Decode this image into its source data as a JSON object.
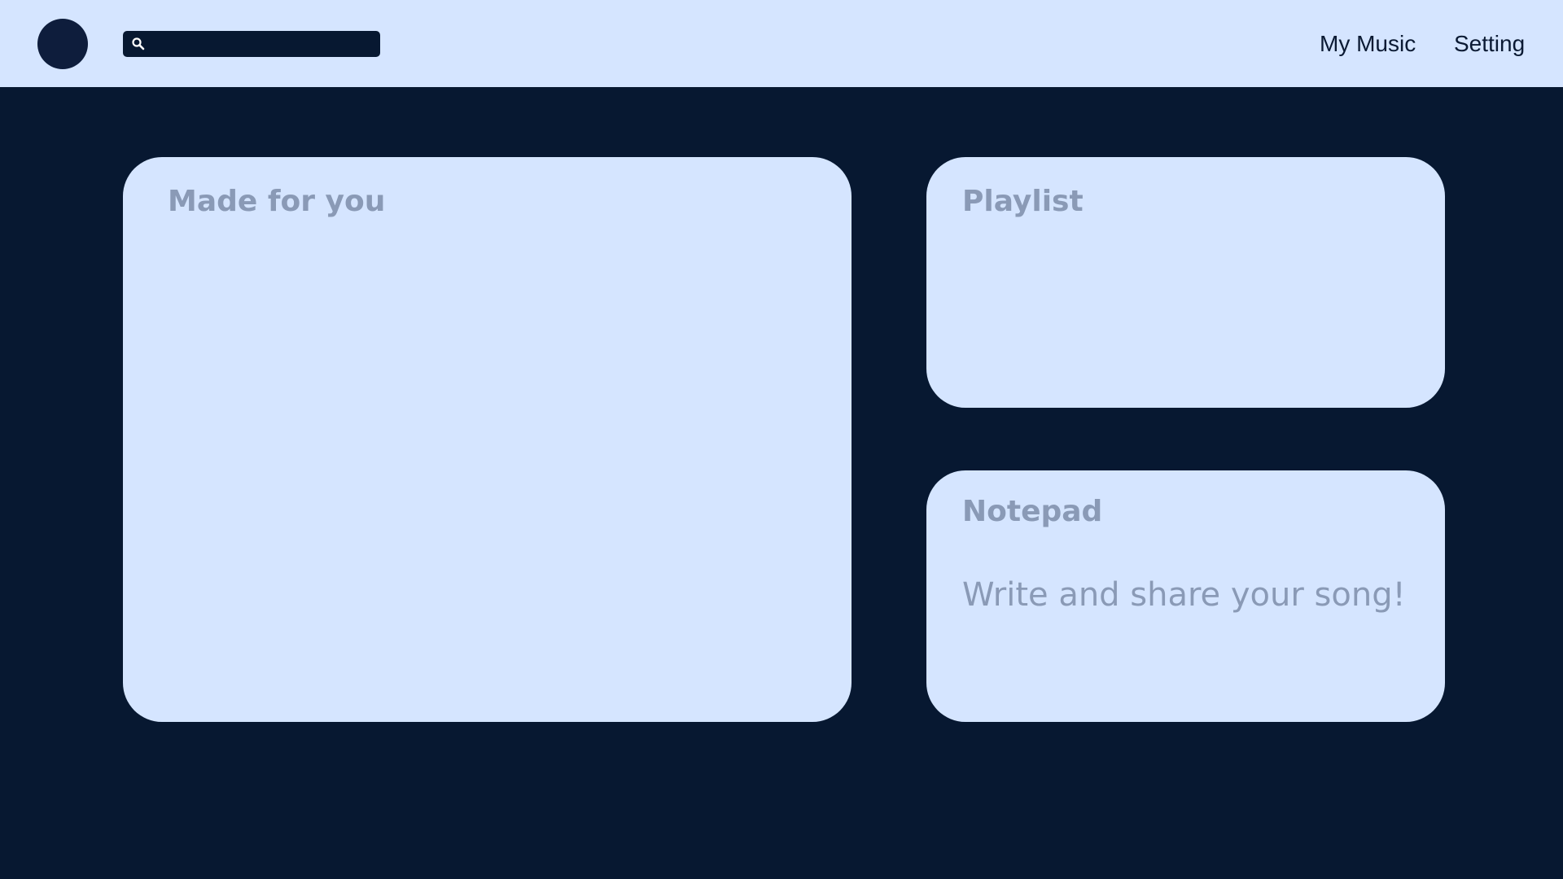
{
  "header": {
    "avatar_icon": "user-avatar",
    "search": {
      "icon": "search-icon",
      "value": "",
      "placeholder": ""
    },
    "nav": {
      "my_music": "My Music",
      "setting": "Setting"
    }
  },
  "cards": {
    "made_for_you": {
      "title": "Made for you"
    },
    "playlist": {
      "title": "Playlist"
    },
    "notepad": {
      "title": "Notepad",
      "placeholder_text": "Write and share your song!"
    }
  },
  "colors": {
    "background": "#071831",
    "surface": "#d5e5ff",
    "muted_text": "#8a9ab6",
    "nav_text": "#0b1a33"
  }
}
